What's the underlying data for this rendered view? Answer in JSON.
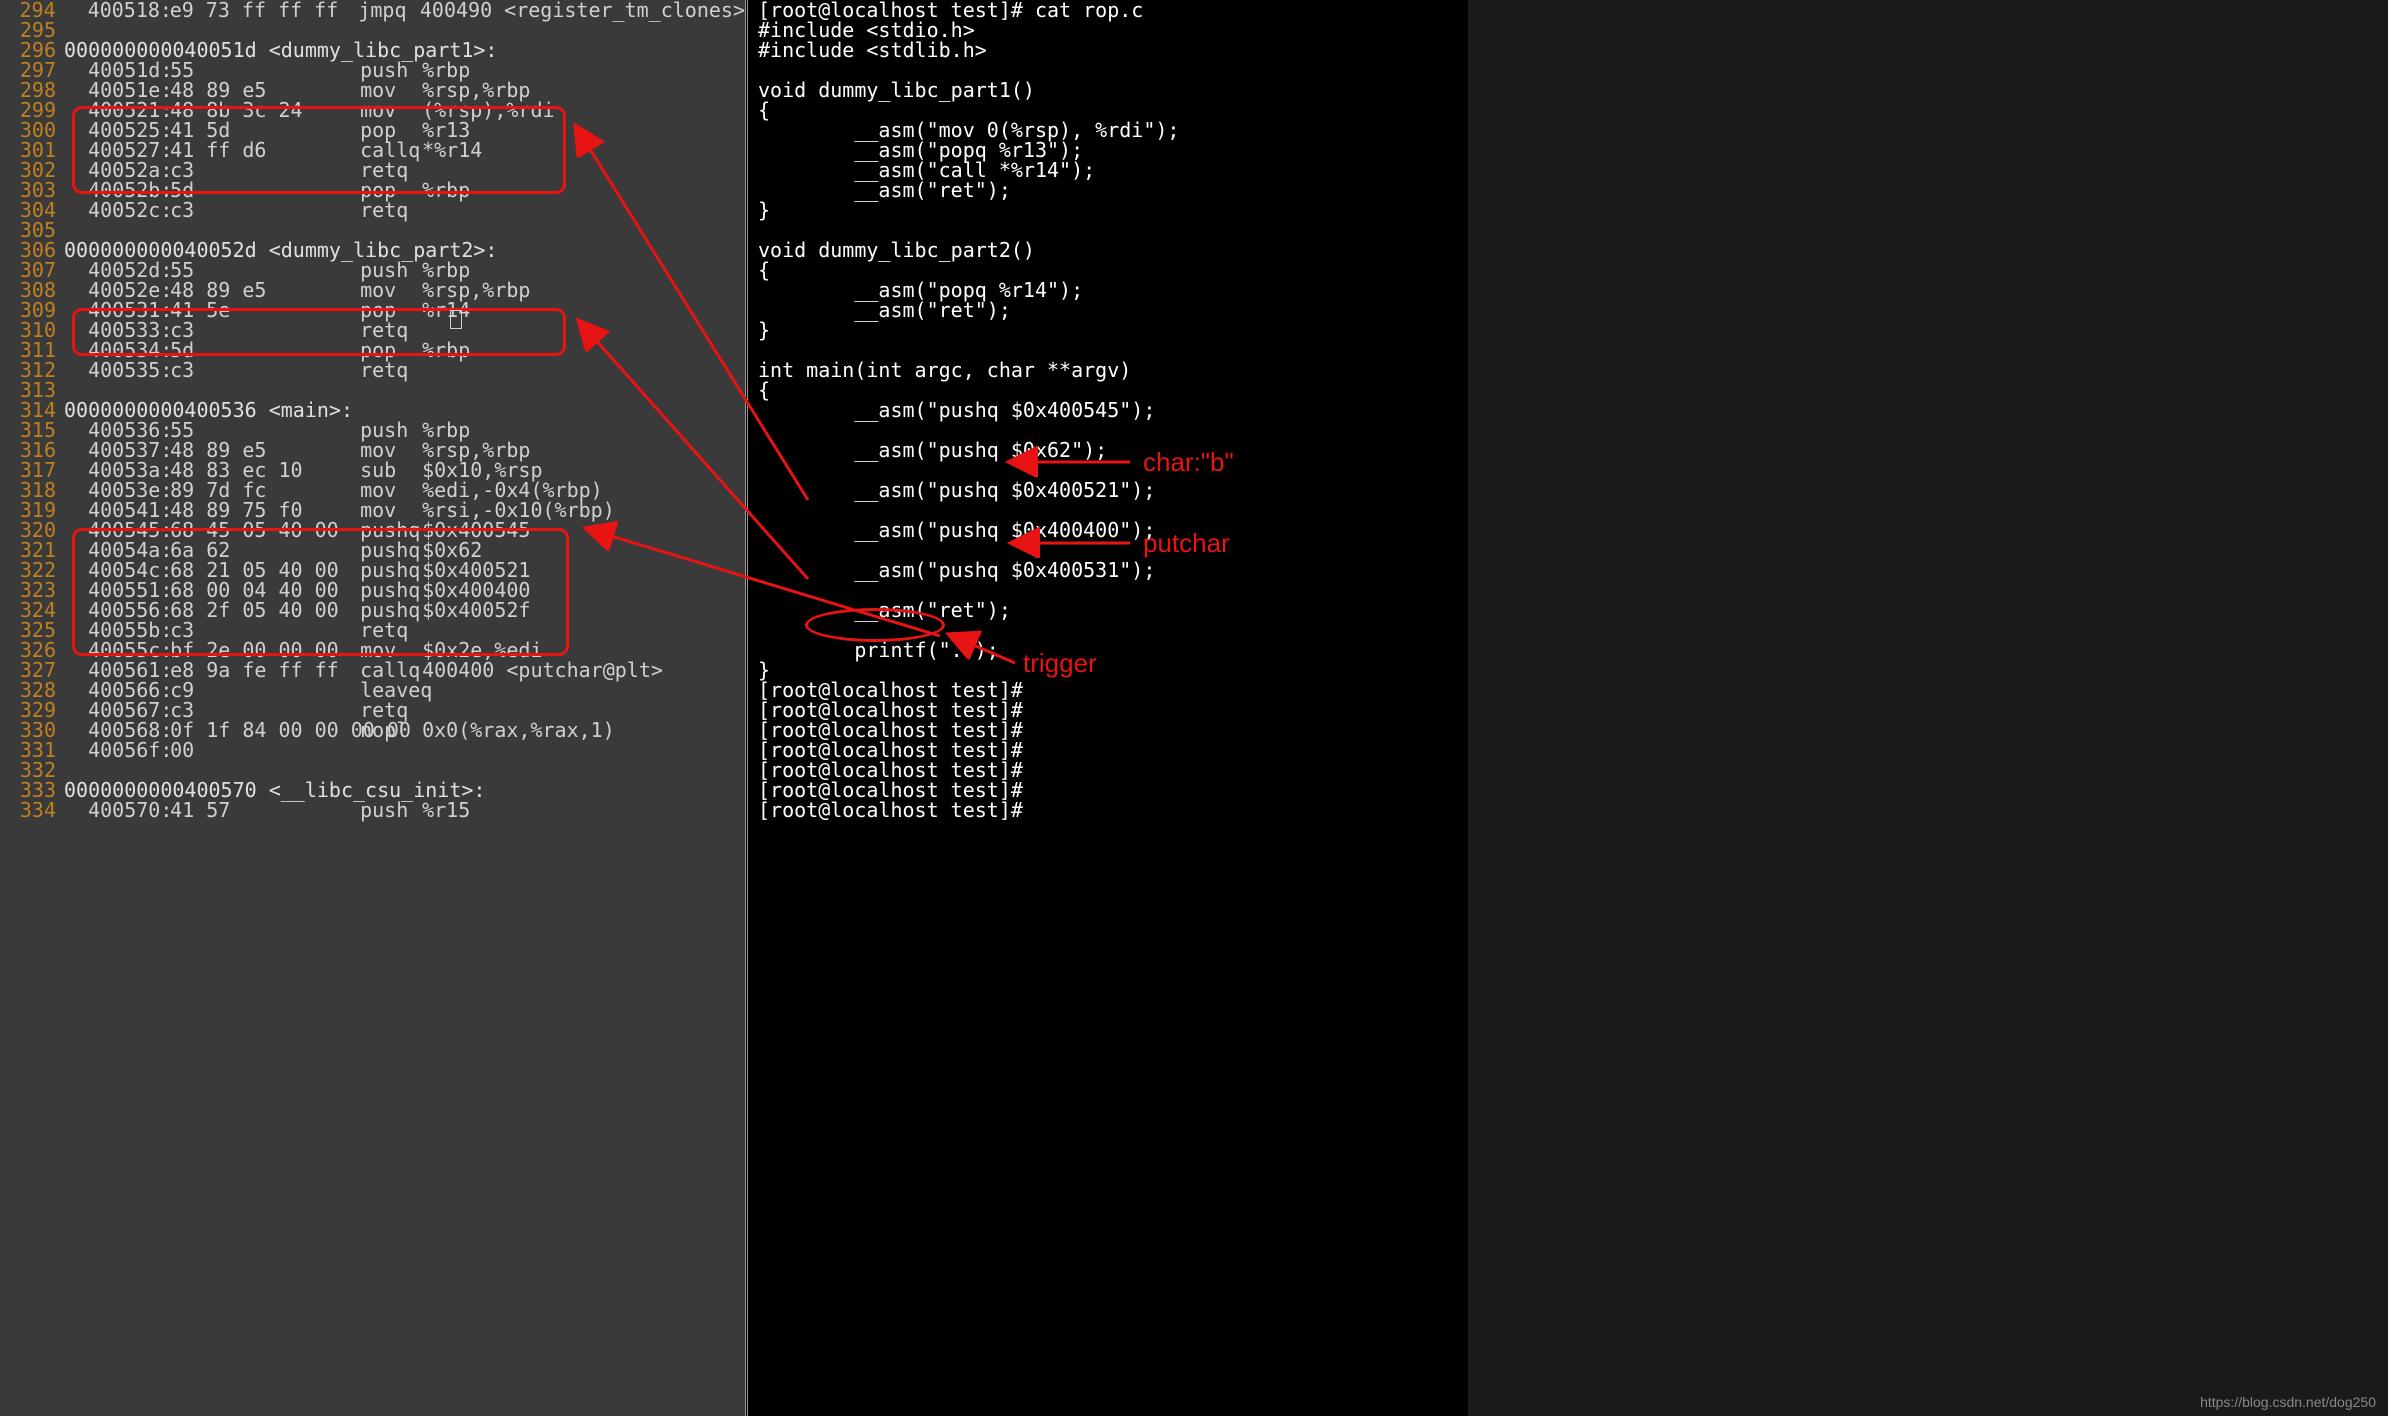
{
  "disasm": [
    {
      "n": "294",
      "addr": "400518:",
      "hex": "e9 73 ff ff ff",
      "mn": "jmpq",
      "op": "400490 <register_tm_clones>"
    },
    {
      "n": "295",
      "addr": "",
      "hex": "",
      "mn": "",
      "op": ""
    },
    {
      "n": "296",
      "fhdr": "000000000040051d <dummy_libc_part1>:"
    },
    {
      "n": "297",
      "addr": "40051d:",
      "hex": "55",
      "mn": "push",
      "op": "%rbp"
    },
    {
      "n": "298",
      "addr": "40051e:",
      "hex": "48 89 e5",
      "mn": "mov",
      "op": "%rsp,%rbp"
    },
    {
      "n": "299",
      "addr": "400521:",
      "hex": "48 8b 3c 24",
      "mn": "mov",
      "op": "(%rsp),%rdi"
    },
    {
      "n": "300",
      "addr": "400525:",
      "hex": "41 5d",
      "mn": "pop",
      "op": "%r13"
    },
    {
      "n": "301",
      "addr": "400527:",
      "hex": "41 ff d6",
      "mn": "callq",
      "op": "*%r14"
    },
    {
      "n": "302",
      "addr": "40052a:",
      "hex": "c3",
      "mn": "retq",
      "op": ""
    },
    {
      "n": "303",
      "addr": "40052b:",
      "hex": "5d",
      "mn": "pop",
      "op": "%rbp"
    },
    {
      "n": "304",
      "addr": "40052c:",
      "hex": "c3",
      "mn": "retq",
      "op": ""
    },
    {
      "n": "305",
      "addr": "",
      "hex": "",
      "mn": "",
      "op": ""
    },
    {
      "n": "306",
      "fhdr": "000000000040052d <dummy_libc_part2>:"
    },
    {
      "n": "307",
      "addr": "40052d:",
      "hex": "55",
      "mn": "push",
      "op": "%rbp"
    },
    {
      "n": "308",
      "addr": "40052e:",
      "hex": "48 89 e5",
      "mn": "mov",
      "op": "%rsp,%rbp"
    },
    {
      "n": "309",
      "addr": "400531:",
      "hex": "41 5e",
      "mn": "pop",
      "op": "%r14"
    },
    {
      "n": "310",
      "addr": "400533:",
      "hex": "c3",
      "mn": "retq",
      "op": ""
    },
    {
      "n": "311",
      "addr": "400534:",
      "hex": "5d",
      "mn": "pop",
      "op": "%rbp"
    },
    {
      "n": "312",
      "addr": "400535:",
      "hex": "c3",
      "mn": "retq",
      "op": ""
    },
    {
      "n": "313",
      "addr": "",
      "hex": "",
      "mn": "",
      "op": ""
    },
    {
      "n": "314",
      "fhdr": "0000000000400536 <main>:"
    },
    {
      "n": "315",
      "addr": "400536:",
      "hex": "55",
      "mn": "push",
      "op": "%rbp"
    },
    {
      "n": "316",
      "addr": "400537:",
      "hex": "48 89 e5",
      "mn": "mov",
      "op": "%rsp,%rbp"
    },
    {
      "n": "317",
      "addr": "40053a:",
      "hex": "48 83 ec 10",
      "mn": "sub",
      "op": "$0x10,%rsp"
    },
    {
      "n": "318",
      "addr": "40053e:",
      "hex": "89 7d fc",
      "mn": "mov",
      "op": "%edi,-0x4(%rbp)"
    },
    {
      "n": "319",
      "addr": "400541:",
      "hex": "48 89 75 f0",
      "mn": "mov",
      "op": "%rsi,-0x10(%rbp)"
    },
    {
      "n": "320",
      "addr": "400545:",
      "hex": "68 45 05 40 00",
      "mn": "pushq",
      "op": "$0x400545"
    },
    {
      "n": "321",
      "addr": "40054a:",
      "hex": "6a 62",
      "mn": "pushq",
      "op": "$0x62"
    },
    {
      "n": "322",
      "addr": "40054c:",
      "hex": "68 21 05 40 00",
      "mn": "pushq",
      "op": "$0x400521"
    },
    {
      "n": "323",
      "addr": "400551:",
      "hex": "68 00 04 40 00",
      "mn": "pushq",
      "op": "$0x400400"
    },
    {
      "n": "324",
      "addr": "400556:",
      "hex": "68 2f 05 40 00",
      "mn": "pushq",
      "op": "$0x40052f"
    },
    {
      "n": "325",
      "addr": "40055b:",
      "hex": "c3",
      "mn": "retq",
      "op": ""
    },
    {
      "n": "326",
      "addr": "40055c:",
      "hex": "bf 2e 00 00 00",
      "mn": "mov",
      "op": "$0x2e,%edi"
    },
    {
      "n": "327",
      "addr": "400561:",
      "hex": "e8 9a fe ff ff",
      "mn": "callq",
      "op": "400400 <putchar@plt>"
    },
    {
      "n": "328",
      "addr": "400566:",
      "hex": "c9",
      "mn": "leaveq",
      "op": ""
    },
    {
      "n": "329",
      "addr": "400567:",
      "hex": "c3",
      "mn": "retq",
      "op": ""
    },
    {
      "n": "330",
      "addr": "400568:",
      "hex": "0f 1f 84 00 00 00 00",
      "mn": "nopl",
      "op": "0x0(%rax,%rax,1)"
    },
    {
      "n": "331",
      "addr": "40056f:",
      "hex": "00",
      "mn": "",
      "op": ""
    },
    {
      "n": "332",
      "addr": "",
      "hex": "",
      "mn": "",
      "op": ""
    },
    {
      "n": "333",
      "fhdr": "0000000000400570 <__libc_csu_init>:"
    },
    {
      "n": "334",
      "addr": "400570:",
      "hex": "41 57",
      "mn": "push",
      "op": "%r15"
    }
  ],
  "source": [
    "[root@localhost test]# cat rop.c",
    "#include <stdio.h>",
    "#include <stdlib.h>",
    "",
    "void dummy_libc_part1()",
    "{",
    "        __asm(\"mov 0(%rsp), %rdi\");",
    "        __asm(\"popq %r13\");",
    "        __asm(\"call *%r14\");",
    "        __asm(\"ret\");",
    "}",
    "",
    "void dummy_libc_part2()",
    "{",
    "        __asm(\"popq %r14\");",
    "        __asm(\"ret\");",
    "}",
    "",
    "int main(int argc, char **argv)",
    "{",
    "        __asm(\"pushq $0x400545\");",
    "",
    "        __asm(\"pushq $0x62\");",
    "",
    "        __asm(\"pushq $0x400521\");",
    "",
    "        __asm(\"pushq $0x400400\");",
    "",
    "        __asm(\"pushq $0x400531\");",
    "",
    "        __asm(\"ret\");",
    "",
    "        printf(\".\");",
    "}",
    "[root@localhost test]#",
    "[root@localhost test]#",
    "[root@localhost test]#",
    "[root@localhost test]#",
    "[root@localhost test]#",
    "[root@localhost test]#",
    "[root@localhost test]#"
  ],
  "annotations": {
    "char_b": "char:\"b\"",
    "putchar": "putchar",
    "trigger": "trigger"
  },
  "watermark": "https://blog.csdn.net/dog250"
}
